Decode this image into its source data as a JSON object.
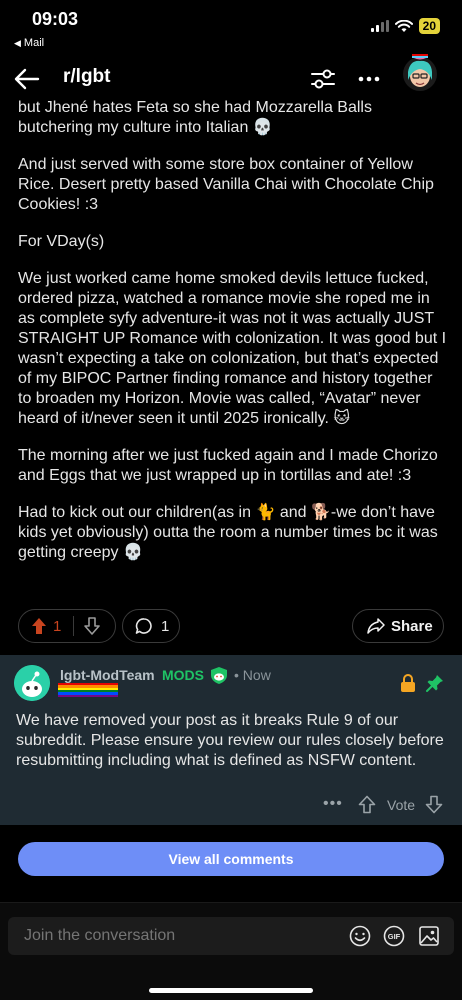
{
  "status": {
    "time": "09:03",
    "back_app": "Mail",
    "battery": "20"
  },
  "nav": {
    "title": "r/lgbt"
  },
  "post": {
    "paragraphs": [
      "but Jhené hates Feta so she had Mozzarella Balls butchering my culture into Italian 💀",
      "And just served with some store box container of Yellow Rice. Desert pretty based Vanilla Chai with Chocolate Chip Cookies! :3",
      "For VDay(s)",
      "We just worked came home smoked devils lettuce fucked, ordered pizza, watched a romance movie she roped me in as complete syfy adventure-it was not it was actually JUST STRAIGHT UP Romance with colonization. It was good but I wasn’t expecting a take on colonization, but that’s expected of my BIPOC Partner finding romance and history together to broaden my Horizon. Movie was called, “Avatar” never heard of it/never seen it until 2025 ironically. 🐱",
      "The morning after we just fucked again and I made Chorizo and Eggs that we just wrapped up in tortillas and ate! :3",
      "Had to kick out our children(as in 🐈 and 🐕-we don’t have kids yet obviously) outta the room a number times bc it was getting creepy 💀"
    ],
    "vote_count": "1",
    "comment_count": "1",
    "share_label": "Share"
  },
  "mod_comment": {
    "author": "lgbt-ModTeam",
    "badge": "MODS",
    "time": "• Now",
    "text": "We have removed your post as it breaks Rule 9 of our subreddit. Please ensure you review our rules closely before resubmitting including what is defined as NSFW content.",
    "more": "•••",
    "vote_label": "Vote",
    "flair_colors": [
      "#e40303",
      "#ff8c00",
      "#ffed00",
      "#008026",
      "#004dff",
      "#750787"
    ]
  },
  "view_all": "View all comments",
  "composer": {
    "placeholder": "Join the conversation",
    "gif_label": "GIF"
  },
  "colors": {
    "upvote": "#c8441f",
    "mod_green": "#1fc365",
    "button_blue": "#6e8ef7",
    "card_bg": "#1f2b33"
  }
}
